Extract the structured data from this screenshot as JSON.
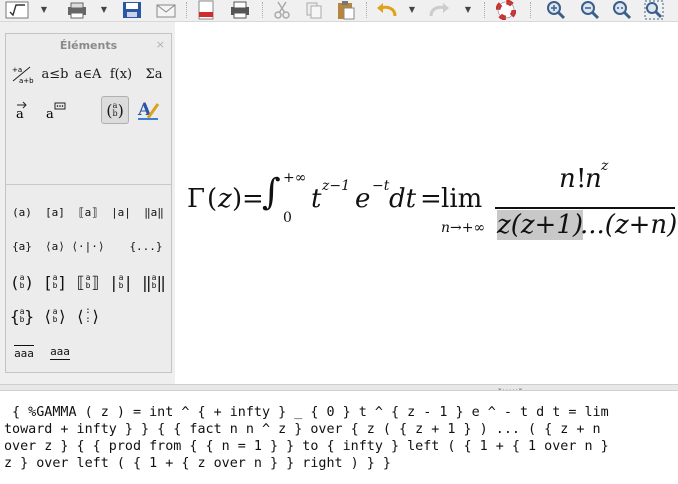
{
  "panel": {
    "title": "Éléments",
    "close": "×",
    "categories": [
      {
        "icon": "unary-binary-ops-icon",
        "label": "+a a+b"
      },
      {
        "icon": "relations-icon",
        "label": "a≤b"
      },
      {
        "icon": "set-operations-icon",
        "label": "a∈A"
      },
      {
        "icon": "functions-icon",
        "label": "f(x)"
      },
      {
        "icon": "operators-icon",
        "label": "Σa"
      },
      {
        "icon": "attributes-icon",
        "label": "a⃗"
      },
      {
        "icon": "others-icon",
        "label": "a"
      },
      {
        "icon": "brackets-icon",
        "label": "(a b)"
      },
      {
        "icon": "formats-icon",
        "label": "A"
      }
    ],
    "brackets": {
      "row1": [
        "(a)",
        "[a]",
        "⟦a⟧",
        "|a|",
        "‖a‖"
      ],
      "row2": [
        "{a}",
        "⟨a⟩",
        "⟨·|·⟩",
        "{...}"
      ],
      "row3_left": [
        "(",
        "[",
        "⟦",
        "|",
        "‖"
      ],
      "row3_right": [
        ")",
        "]",
        "⟧",
        "|",
        "‖"
      ],
      "row4_left": [
        "{",
        "⟨",
        "⟨"
      ],
      "row4_right": [
        "}",
        "⟩",
        "⟩"
      ],
      "stack_top": "a",
      "stack_bottom": "b",
      "row5": [
        "aaa",
        "aaa"
      ]
    }
  },
  "formula": {
    "gamma": "Γ",
    "arg_open": "(",
    "var_z": "z",
    "arg_close": ")",
    "equals": "=",
    "integral": "∫",
    "int_upper": "+∞",
    "int_lower": "0",
    "t_base": "t",
    "t_exp": "z−1",
    "e_base": "e",
    "e_exp": "−t",
    "dt": "dt",
    "equals2": "=",
    "lim": "lim",
    "lim_sub": "n→+∞",
    "numerator_n": "n",
    "numerator_fact": "!",
    "numerator_n2": "n",
    "numerator_exp": "z",
    "denominator_hl": "z(z+1)",
    "denominator_rest": "...(z+n)"
  },
  "command": {
    "lines": [
      " { %GAMMA ( z ) = int ^ { + infty } _ { 0 } t ^ { z - 1 } e ^ - t d t = lim",
      "toward + infty } } { { fact n n ^ z } over { z ( { z + 1 } ) ... ( { z + n",
      "over z } { { prod from { { n = 1 } } to { infty } left ( { 1 + { 1 over n }",
      "z } over left ( { 1 + { z over n } } right ) } }"
    ]
  }
}
